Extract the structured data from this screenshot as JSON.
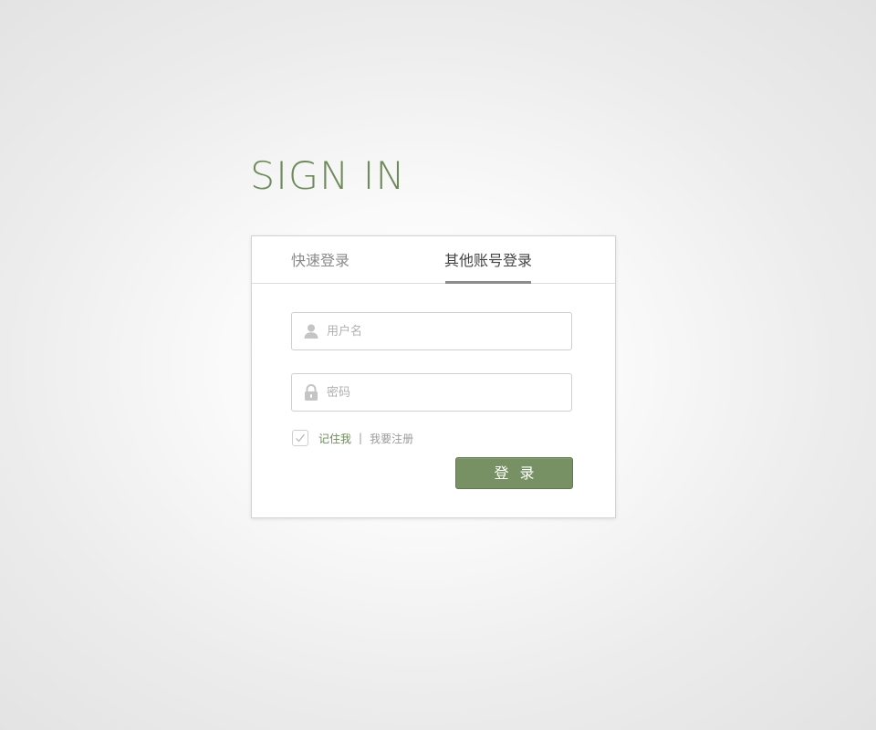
{
  "page": {
    "title": "SIGN IN"
  },
  "tabs": [
    {
      "label": "快速登录",
      "active": false
    },
    {
      "label": "其他账号登录",
      "active": true
    }
  ],
  "form": {
    "username": {
      "placeholder": "用户名",
      "value": "",
      "icon": "user-icon"
    },
    "password": {
      "placeholder": "密码",
      "value": "",
      "icon": "lock-icon"
    },
    "remember": {
      "label": "记住我",
      "checked": true
    },
    "divider": "|",
    "register_label": "我要注册",
    "submit_label": "登录"
  },
  "colors": {
    "accent": "#779164",
    "title": "#6f8b5c",
    "tab_underline": "#8c8c8c"
  }
}
